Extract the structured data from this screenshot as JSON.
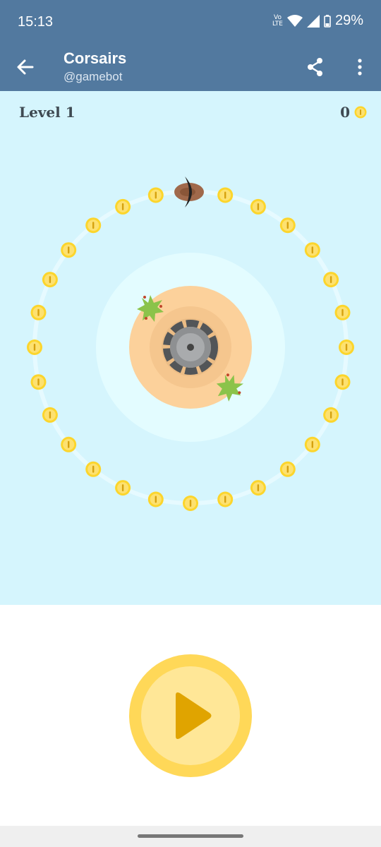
{
  "status_bar": {
    "time": "15:13",
    "network_label": "Vo LTE",
    "battery_percent": "29%",
    "icons": [
      "volte-icon",
      "wifi-icon",
      "signal-icon",
      "battery-icon"
    ]
  },
  "app_bar": {
    "title": "Corsairs",
    "subtitle": "@gamebot",
    "icons": [
      "back-arrow-icon",
      "share-icon",
      "more-vert-icon"
    ]
  },
  "game": {
    "level_label": "Level 1",
    "score": "0",
    "coin_count": 28,
    "colors": {
      "sea": "#D5F5FD",
      "shallow": "#E3FCFF",
      "island": "#FCD19B",
      "tower_ring": "#525558",
      "tower_center": "#A9ABAD",
      "coin": "#FCD52C",
      "palm": "#8BC34A",
      "ship_hull": "#A0694B",
      "sail": "#222222"
    }
  },
  "controls": {
    "play_icon": "play-icon",
    "colors": {
      "outer": "#FFD858",
      "inner": "#FFE797",
      "triangle": "#E0A400"
    }
  }
}
